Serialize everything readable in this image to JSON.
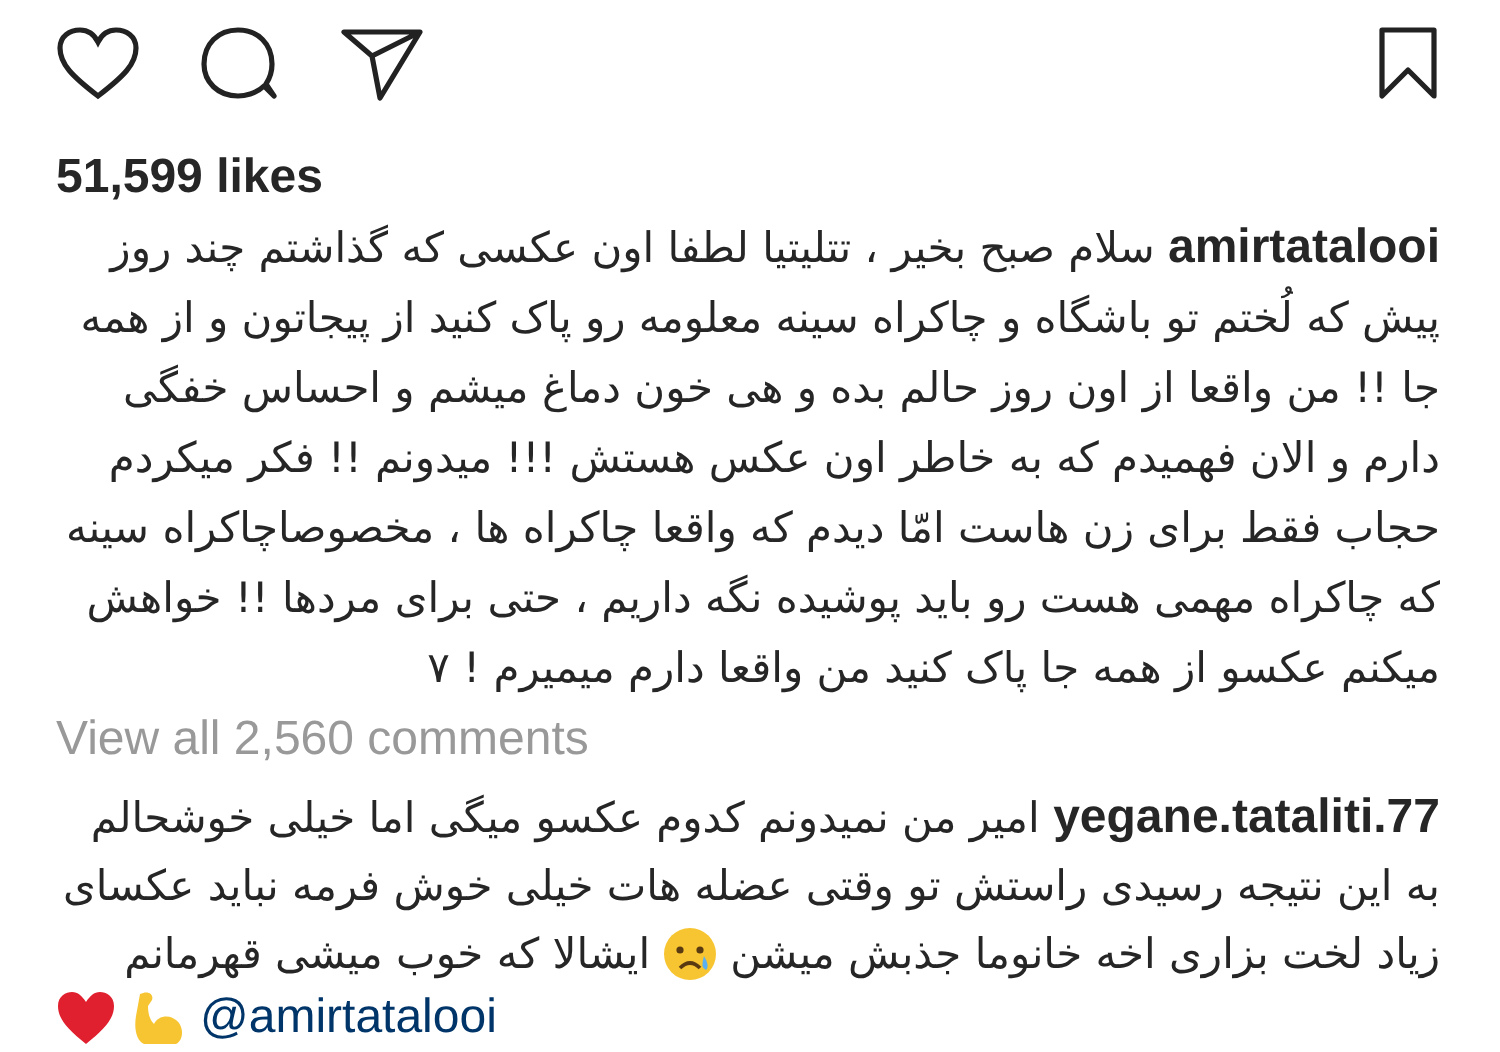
{
  "likes": "51,599 likes",
  "caption": "**amirtatalooi** سلام صبح بخیر ، تتلیتیا لطفا اون عکسی که گذاشتم چند روز پیش که لُختم تو باشگاه و چاکراه سینه معلومه رو پاک کنید از پیجاتون و از همه جا !! من واقعا از اون روز حالم بده و هی خون دماغ میشم و احساس خفگی دارم و الان فهمیدم که به خاطر اون عکس هستش !!! میدونم !! فکر میکردم حجاب فقط برای زن هاست امّا دیدم که واقعا چاکراه ها ، مخصوصاچاکراه سینه که چاکراه مهمی هست رو باید پوشیده نگه داریم ، حتی برای مردها !! خواهش میکنم عکسو از همه جا پاک کنید من واقعا دارم میمیرم ! ۷",
  "view_all": "View all 2,560 comments",
  "comment": {
    "body": "**yegane.tataliti.77** امیر من نمیدونم کدوم عکسو میگی اما خیلی خوشحالم به این نتیجه رسیدی راستش تو وقتی عضله هات خیلی خوش فرمه نباید عکسای",
    "segments": [
      {
        "kind": "text",
        "text": "زیاد لخت بزاری اخه خانوما جذبش میشن"
      },
      {
        "kind": "sad-emoji"
      },
      {
        "kind": "text",
        "text": "ایشالا که خوب میشی قهرمانم"
      }
    ],
    "mention": "@amirtatalooi"
  }
}
